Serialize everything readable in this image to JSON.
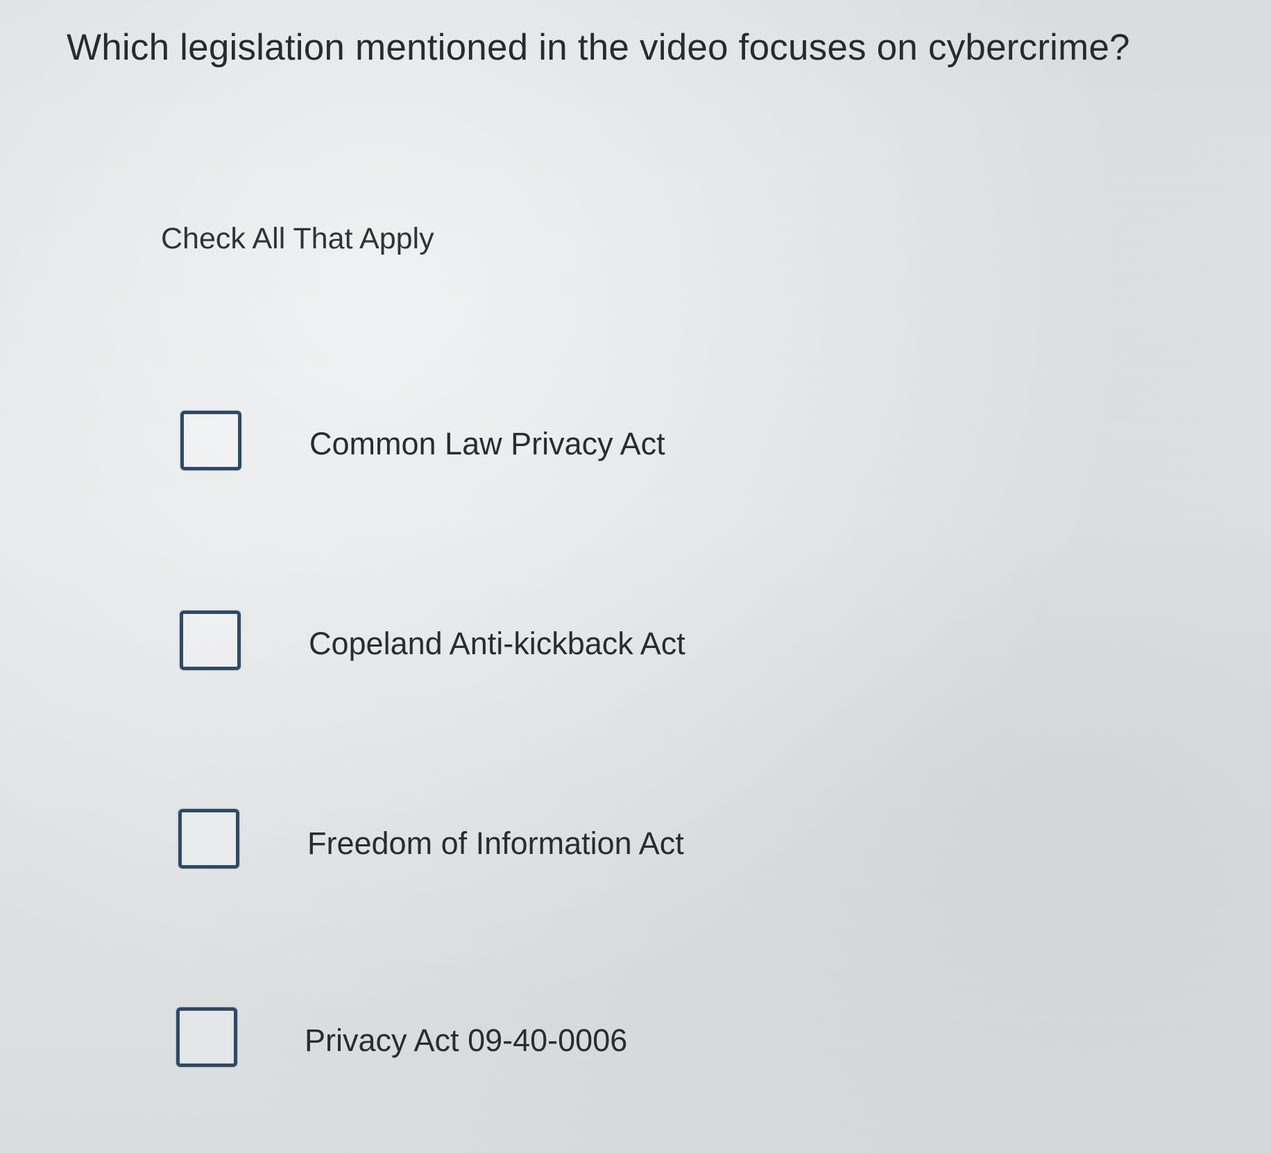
{
  "question": {
    "text": "Which legislation mentioned in the video focuses on cybercrime?"
  },
  "instruction": {
    "text": "Check All That Apply"
  },
  "options": [
    {
      "label": "Common Law Privacy Act",
      "checked": false
    },
    {
      "label": "Copeland Anti-kickback Act",
      "checked": false
    },
    {
      "label": "Freedom of Information Act",
      "checked": false
    },
    {
      "label": "Privacy Act 09-40-0006",
      "checked": false
    }
  ],
  "colors": {
    "checkbox_border": "#2f4a66",
    "text": "#2b2b2b",
    "background": "#dcdfe1"
  }
}
